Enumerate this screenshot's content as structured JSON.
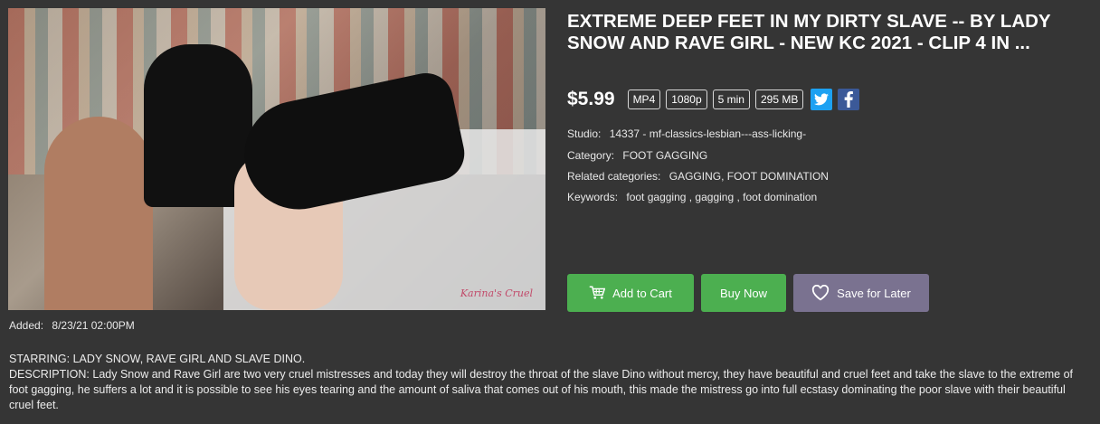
{
  "product": {
    "title": "EXTREME DEEP FEET IN MY DIRTY SLAVE -- BY LADY SNOW AND RAVE GIRL - NEW KC 2021 - CLIP 4 IN ...",
    "price": "$5.99",
    "tags": [
      "MP4",
      "1080p",
      "5 min",
      "295 MB"
    ],
    "watermark": "Karina's Cruel",
    "studio_label": "Studio:",
    "studio_value": "14337 - mf-classics-lesbian---ass-licking-",
    "category_label": "Category:",
    "category_value": "FOOT GAGGING",
    "related_label": "Related categories:",
    "related_value": "GAGGING, FOOT DOMINATION",
    "keywords_label": "Keywords:",
    "keywords_value": "foot gagging , gagging , foot domination",
    "added_label": "Added:",
    "added_value": "8/23/21 02:00PM"
  },
  "buttons": {
    "add_to_cart": "Add to Cart",
    "buy_now": "Buy Now",
    "save_for_later": "Save for Later"
  },
  "description": {
    "starring": "STARRING: LADY SNOW, RAVE GIRL AND SLAVE DINO.",
    "text": "DESCRIPTION: Lady Snow and Rave Girl are two very cruel mistresses and today they will destroy the throat of the slave Dino without mercy, they have beautiful and cruel feet and take the slave to the extreme of foot gagging, he suffers a lot and it is possible to see his eyes tearing and the amount of saliva that comes out of his mouth, this made the mistress go into full ecstasy dominating the poor slave with their beautiful cruel feet."
  },
  "icons": {
    "twitter": "twitter-icon",
    "facebook": "facebook-icon",
    "cart": "cart-icon",
    "heart": "heart-icon"
  },
  "colors": {
    "background": "#353535",
    "green_button": "#4caf50",
    "save_button": "#7a7290",
    "twitter": "#1da1f2",
    "facebook": "#3b5998"
  }
}
